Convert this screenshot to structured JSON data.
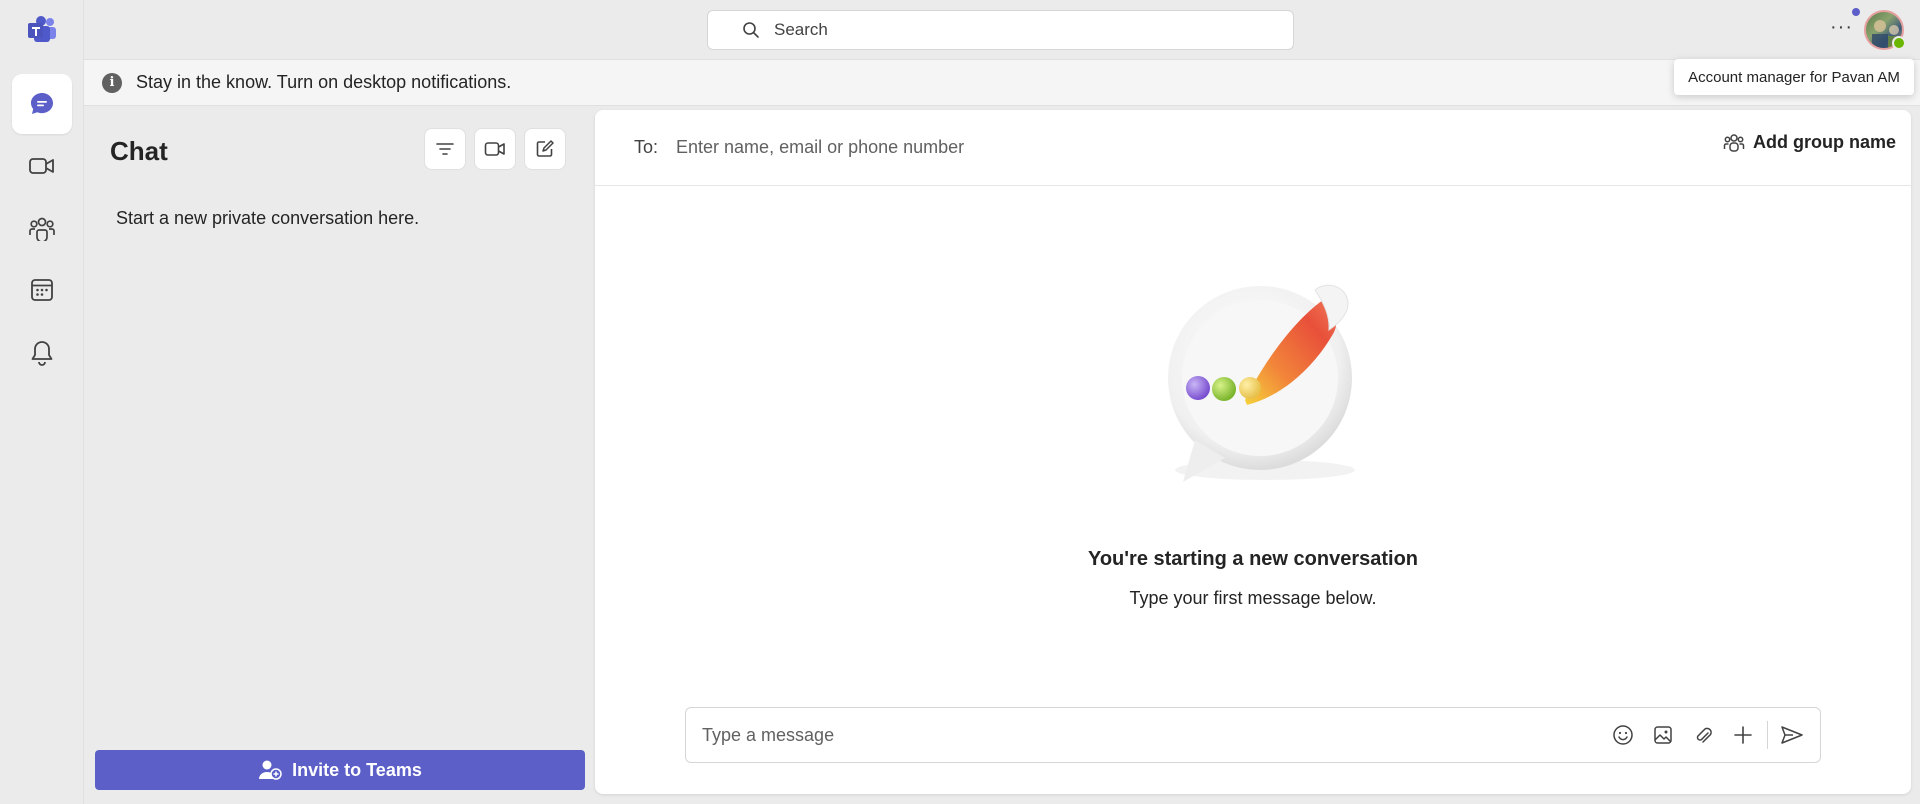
{
  "search": {
    "placeholder": "Search"
  },
  "notification": {
    "text": "Stay in the know. Turn on desktop notifications."
  },
  "tooltip": {
    "text": "Account manager for Pavan AM"
  },
  "rail": {
    "items": [
      {
        "name": "chat",
        "icon": "chat-icon",
        "active": true
      },
      {
        "name": "meet",
        "icon": "video-icon"
      },
      {
        "name": "communities",
        "icon": "people-icon"
      },
      {
        "name": "calendar",
        "icon": "calendar-icon"
      },
      {
        "name": "activity",
        "icon": "bell-icon"
      }
    ]
  },
  "chatpane": {
    "title": "Chat",
    "empty_hint": "Start a new private conversation here.",
    "invite_label": "Invite to Teams"
  },
  "conversation": {
    "to_label": "To:",
    "to_placeholder": "Enter name, email or phone number",
    "add_group_label": "Add group name",
    "empty_title": "You're starting a new conversation",
    "empty_subtitle": "Type your first message below.",
    "composer_placeholder": "Type a message"
  },
  "colors": {
    "accent": "#5b5fc7",
    "presence": "#6bb700"
  }
}
